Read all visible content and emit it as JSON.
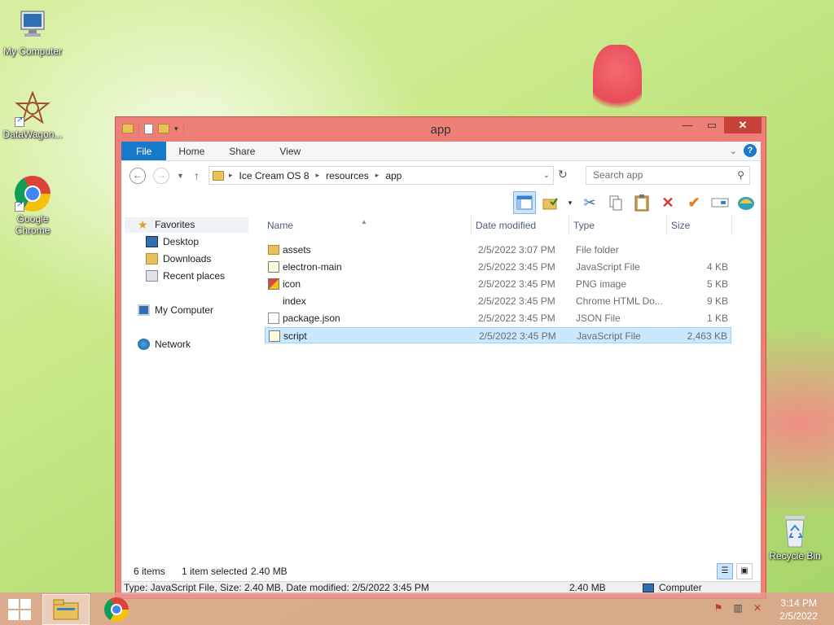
{
  "desktop": {
    "icons": [
      {
        "label": "My Computer"
      },
      {
        "label": "DataWagon..."
      },
      {
        "label": "Google Chrome"
      },
      {
        "label": "Recycle Bin"
      }
    ]
  },
  "window": {
    "title": "app",
    "ribbon_tabs": [
      "File",
      "Home",
      "Share",
      "View"
    ],
    "breadcrumb": [
      "Ice Cream OS 8",
      "resources",
      "app"
    ],
    "search_placeholder": "Search app"
  },
  "sidebar": {
    "favorites": "Favorites",
    "items": [
      "Desktop",
      "Downloads",
      "Recent places"
    ],
    "computer": "My Computer",
    "network": "Network"
  },
  "columns": [
    "Name",
    "Date modified",
    "Type",
    "Size"
  ],
  "files": [
    {
      "name": "assets",
      "date": "2/5/2022 3:07 PM",
      "type": "File folder",
      "size": "",
      "icon": "folder-icon"
    },
    {
      "name": "electron-main",
      "date": "2/5/2022 3:45 PM",
      "type": "JavaScript File",
      "size": "4 KB",
      "icon": "javascript-file-icon"
    },
    {
      "name": "icon",
      "date": "2/5/2022 3:45 PM",
      "type": "PNG image",
      "size": "5 KB",
      "icon": "png-image-icon"
    },
    {
      "name": "index",
      "date": "2/5/2022 3:45 PM",
      "type": "Chrome HTML Do...",
      "size": "9 KB",
      "icon": "chrome-html-icon"
    },
    {
      "name": "package.json",
      "date": "2/5/2022 3:45 PM",
      "type": "JSON File",
      "size": "1 KB",
      "icon": "json-file-icon"
    },
    {
      "name": "script",
      "date": "2/5/2022 3:45 PM",
      "type": "JavaScript File",
      "size": "2,463 KB",
      "icon": "javascript-file-icon",
      "selected": true
    }
  ],
  "status": {
    "count": "6 items",
    "selected": "1 item selected",
    "selected_size": "2.40 MB"
  },
  "infobar": {
    "details": "Type: JavaScript File, Size: 2.40 MB, Date modified: 2/5/2022 3:45 PM",
    "size": "2.40 MB",
    "location": "Computer"
  },
  "taskbar": {
    "time": "3:14 PM",
    "date": "2/5/2022"
  },
  "colors": {
    "window_frame": "#ed7f77",
    "accent": "#1979ca",
    "selection": "#cce8ff"
  }
}
